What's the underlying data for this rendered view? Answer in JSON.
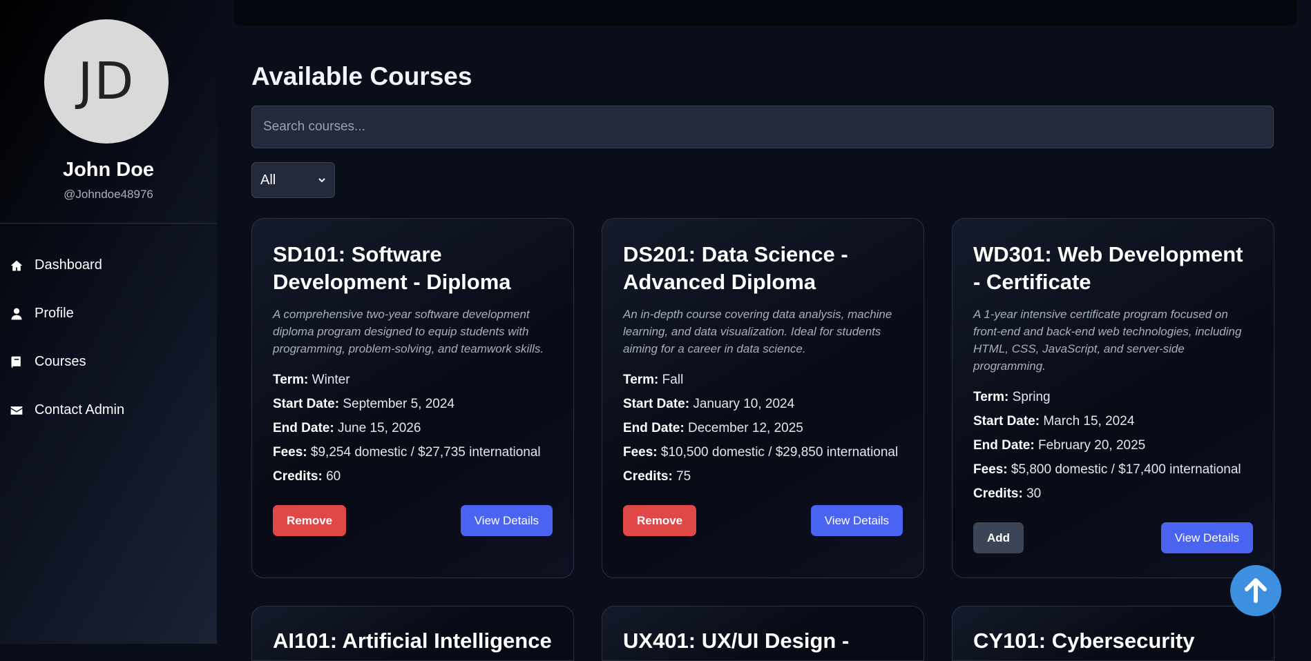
{
  "user": {
    "initials": "JD",
    "name": "John Doe",
    "handle": "@Johndoe48976"
  },
  "nav": [
    {
      "label": "Dashboard",
      "icon": "home-icon"
    },
    {
      "label": "Profile",
      "icon": "user-icon"
    },
    {
      "label": "Courses",
      "icon": "book-icon"
    },
    {
      "label": "Contact Admin",
      "icon": "envelope-icon"
    }
  ],
  "main": {
    "title": "Available Courses",
    "search_placeholder": "Search courses...",
    "term_filter": "All"
  },
  "labels": {
    "term": "Term:",
    "start": "Start Date:",
    "end": "End Date:",
    "fees": "Fees:",
    "credits": "Credits:",
    "view": "View Details"
  },
  "courses": [
    {
      "title": "SD101: Software Development - Diploma",
      "description": "A comprehensive two-year software development diploma program designed to equip students with programming, problem-solving, and teamwork skills.",
      "term": "Winter",
      "start": "September 5, 2024",
      "end": "June 15, 2026",
      "fees": "$9,254 domestic / $27,735 international",
      "credits": "60",
      "action": "Remove"
    },
    {
      "title": "DS201: Data Science - Advanced Diploma",
      "description": "An in-depth course covering data analysis, machine learning, and data visualization. Ideal for students aiming for a career in data science.",
      "term": "Fall",
      "start": "January 10, 2024",
      "end": "December 12, 2025",
      "fees": "$10,500 domestic / $29,850 international",
      "credits": "75",
      "action": "Remove"
    },
    {
      "title": "WD301: Web Development - Certificate",
      "description": "A 1-year intensive certificate program focused on front-end and back-end web technologies, including HTML, CSS, JavaScript, and server-side programming.",
      "term": "Spring",
      "start": "March 15, 2024",
      "end": "February 20, 2025",
      "fees": "$5,800 domestic / $17,400 international",
      "credits": "30",
      "action": "Add"
    }
  ],
  "partial_courses": [
    "AI101: Artificial Intelligence",
    "UX401: UX/UI Design -",
    "CY101: Cybersecurity"
  ],
  "colors": {
    "accent": "#4a63f0",
    "danger": "#e04848",
    "scroll_button": "#3d8fe0"
  }
}
